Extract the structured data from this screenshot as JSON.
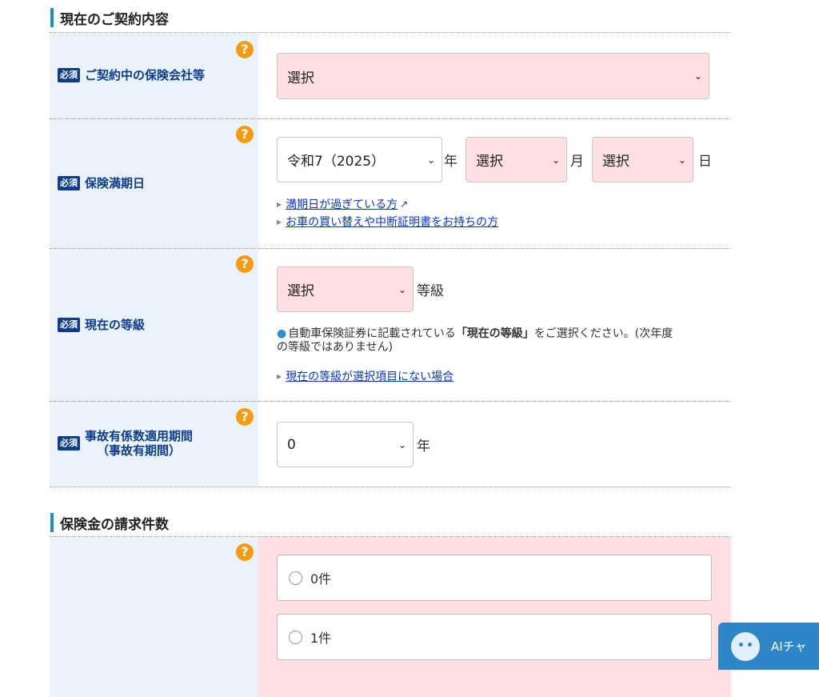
{
  "section1": {
    "title": "現在のご契約内容"
  },
  "required_badge": "必須",
  "help_glyph": "?",
  "rows": {
    "insurer": {
      "label": "ご契約中の保険会社等",
      "select_value": "選択"
    },
    "expiry": {
      "label": "保険満期日",
      "year_value": "令和7（2025）",
      "year_unit": "年",
      "month_value": "選択",
      "month_unit": "月",
      "day_value": "選択",
      "day_unit": "日",
      "link1": "満期日が過ぎている方",
      "link2": "お車の買い替えや中断証明書をお持ちの方"
    },
    "grade": {
      "label": "現在の等級",
      "select_value": "選択",
      "unit": "等級",
      "note_pre": "自動車保険証券に記載されている",
      "note_bold": "「現在の等級」",
      "note_post": "をご選択ください。(次年度",
      "note_line2": "の等級ではありません)",
      "link": "現在の等級が選択項目にない場合"
    },
    "accident": {
      "label_line1": "事故有係数適用期間",
      "label_line2": "（事故有期間）",
      "select_value": "0",
      "unit": "年"
    }
  },
  "section2": {
    "title": "保険金の請求件数"
  },
  "claims": {
    "options": [
      "0件",
      "1件"
    ]
  },
  "ai_chat": {
    "label": "AIチャ"
  },
  "icons": {
    "select": "chevron-down-icon",
    "external": "external-link-icon",
    "help": "help-icon"
  },
  "colors": {
    "accent": "#1a8fc9",
    "badge": "#0d3c8c",
    "label_bg": "#eaf3fb",
    "pink": "#ffdfe0",
    "help": "#f39c12",
    "link": "#0b36c8"
  }
}
